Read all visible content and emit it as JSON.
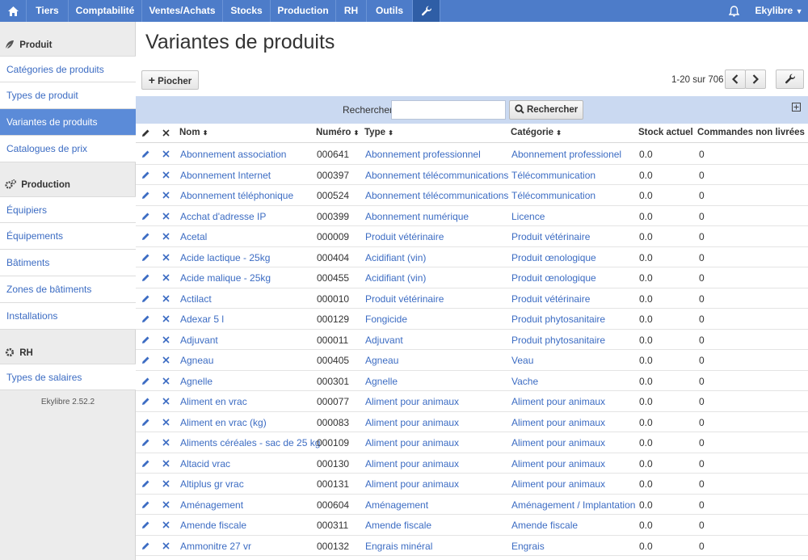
{
  "nav": {
    "items": [
      {
        "label": ""
      },
      {
        "label": "Tiers"
      },
      {
        "label": "Comptabilité"
      },
      {
        "label": "Ventes/Achats"
      },
      {
        "label": "Stocks"
      },
      {
        "label": "Production"
      },
      {
        "label": "RH"
      },
      {
        "label": "Outils"
      },
      {
        "label": ""
      }
    ],
    "user": "Ekylibre"
  },
  "sidebar": {
    "sections": [
      {
        "title": "Produit",
        "items": [
          "Catégories de produits",
          "Types de produit",
          "Variantes de produits",
          "Catalogues de prix"
        ]
      },
      {
        "title": "Production",
        "items": [
          "Équipiers",
          "Équipements",
          "Bâtiments",
          "Zones de bâtiments",
          "Installations"
        ]
      },
      {
        "title": "RH",
        "items": [
          "Types de salaires"
        ]
      }
    ],
    "version": "Ekylibre 2.52.2"
  },
  "page": {
    "title": "Variantes de produits",
    "pick_button": "Piocher",
    "pagination": "1-20 sur 706"
  },
  "search": {
    "label": "Rechercher",
    "value": "",
    "button": "Rechercher"
  },
  "table": {
    "columns": {
      "name": "Nom",
      "number": "Numéro",
      "type": "Type",
      "category": "Catégorie",
      "stock": "Stock actuel",
      "orders": "Commandes non livrées"
    },
    "rows": [
      {
        "name": "Abonnement association",
        "number": "000641",
        "type": "Abonnement professionnel",
        "category": "Abonnement professionel",
        "stock": "0.0",
        "orders": "0"
      },
      {
        "name": "Abonnement Internet",
        "number": "000397",
        "type": "Abonnement télécommunications",
        "category": "Télécommunication",
        "stock": "0.0",
        "orders": "0"
      },
      {
        "name": "Abonnement téléphonique",
        "number": "000524",
        "type": "Abonnement télécommunications",
        "category": "Télécommunication",
        "stock": "0.0",
        "orders": "0"
      },
      {
        "name": "Acchat d'adresse IP",
        "number": "000399",
        "type": "Abonnement numérique",
        "category": "Licence",
        "stock": "0.0",
        "orders": "0"
      },
      {
        "name": "Acetal",
        "number": "000009",
        "type": "Produit vétérinaire",
        "category": "Produit vétérinaire",
        "stock": "0.0",
        "orders": "0"
      },
      {
        "name": "Acide lactique - 25kg",
        "number": "000404",
        "type": "Acidifiant (vin)",
        "category": "Produit œnologique",
        "stock": "0.0",
        "orders": "0"
      },
      {
        "name": "Acide malique - 25kg",
        "number": "000455",
        "type": "Acidifiant (vin)",
        "category": "Produit œnologique",
        "stock": "0.0",
        "orders": "0"
      },
      {
        "name": "Actilact",
        "number": "000010",
        "type": "Produit vétérinaire",
        "category": "Produit vétérinaire",
        "stock": "0.0",
        "orders": "0"
      },
      {
        "name": "Adexar 5 l",
        "number": "000129",
        "type": "Fongicide",
        "category": "Produit phytosanitaire",
        "stock": "0.0",
        "orders": "0"
      },
      {
        "name": "Adjuvant",
        "number": "000011",
        "type": "Adjuvant",
        "category": "Produit phytosanitaire",
        "stock": "0.0",
        "orders": "0"
      },
      {
        "name": "Agneau",
        "number": "000405",
        "type": "Agneau",
        "category": "Veau",
        "stock": "0.0",
        "orders": "0"
      },
      {
        "name": "Agnelle",
        "number": "000301",
        "type": "Agnelle",
        "category": "Vache",
        "stock": "0.0",
        "orders": "0"
      },
      {
        "name": "Aliment en vrac",
        "number": "000077",
        "type": "Aliment pour animaux",
        "category": "Aliment pour animaux",
        "stock": "0.0",
        "orders": "0"
      },
      {
        "name": "Aliment en vrac (kg)",
        "number": "000083",
        "type": "Aliment pour animaux",
        "category": "Aliment pour animaux",
        "stock": "0.0",
        "orders": "0"
      },
      {
        "name": "Aliments céréales - sac de 25 kg",
        "number": "000109",
        "type": "Aliment pour animaux",
        "category": "Aliment pour animaux",
        "stock": "0.0",
        "orders": "0"
      },
      {
        "name": "Altacid vrac",
        "number": "000130",
        "type": "Aliment pour animaux",
        "category": "Aliment pour animaux",
        "stock": "0.0",
        "orders": "0"
      },
      {
        "name": "Altiplus gr vrac",
        "number": "000131",
        "type": "Aliment pour animaux",
        "category": "Aliment pour animaux",
        "stock": "0.0",
        "orders": "0"
      },
      {
        "name": "Aménagement",
        "number": "000604",
        "type": "Aménagement",
        "category": "Aménagement / Implantation",
        "stock": "0.0",
        "orders": "0"
      },
      {
        "name": "Amende fiscale",
        "number": "000311",
        "type": "Amende fiscale",
        "category": "Amende fiscale",
        "stock": "0.0",
        "orders": "0"
      },
      {
        "name": "Ammonitre 27 vr",
        "number": "000132",
        "type": "Engrais minéral",
        "category": "Engrais",
        "stock": "0.0",
        "orders": "0"
      }
    ]
  },
  "colors": {
    "topbar": "#4d7cc9",
    "link": "#3c6cc3",
    "active": "#5b8bd8",
    "searchbar": "#cad9f1"
  }
}
